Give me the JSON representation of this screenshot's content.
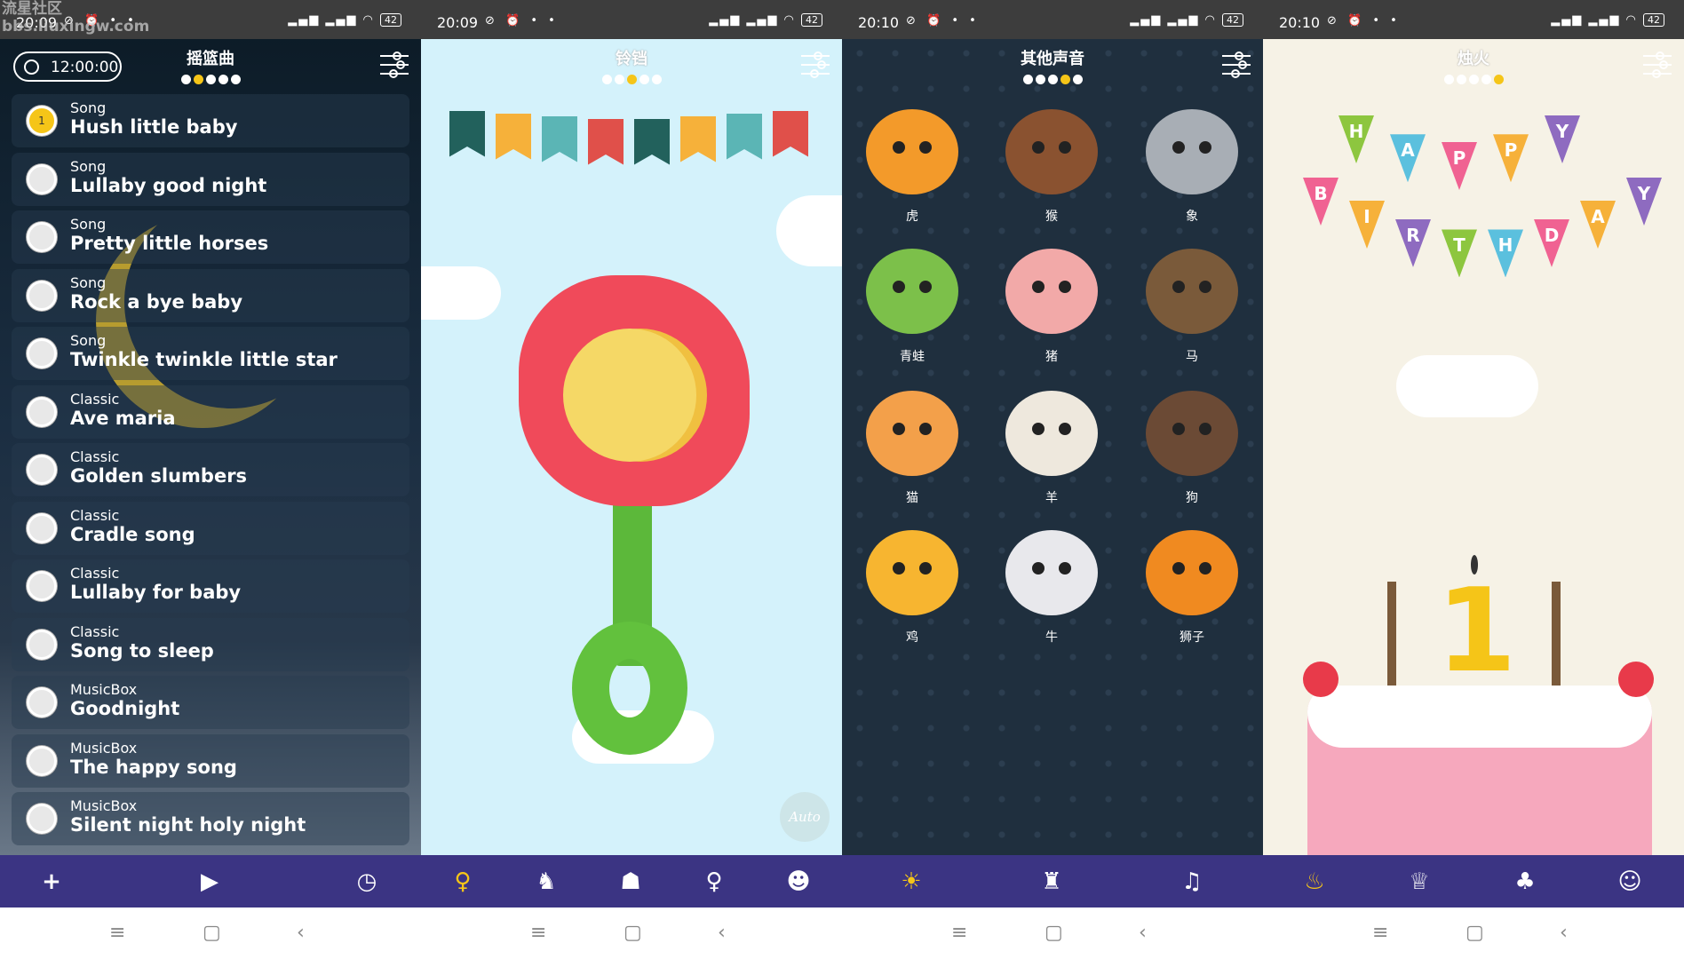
{
  "watermark": [
    "流星社区",
    "bbs.liuxingw.com"
  ],
  "status": [
    {
      "time": "20:09",
      "battery": "42"
    },
    {
      "time": "20:09",
      "battery": "42"
    },
    {
      "time": "20:10",
      "battery": "42"
    },
    {
      "time": "20:10",
      "battery": "42"
    }
  ],
  "lullaby": {
    "title": "摇篮曲",
    "timer": "12:00:00",
    "active_dot": 1,
    "items": [
      {
        "cat": "Song",
        "name": "Hush little baby",
        "selected": "1"
      },
      {
        "cat": "Song",
        "name": "Lullaby good night"
      },
      {
        "cat": "Song",
        "name": "Pretty little horses"
      },
      {
        "cat": "Song",
        "name": "Rock a bye baby"
      },
      {
        "cat": "Song",
        "name": "Twinkle twinkle little star"
      },
      {
        "cat": "Classic",
        "name": "Ave maria"
      },
      {
        "cat": "Classic",
        "name": "Golden slumbers"
      },
      {
        "cat": "Classic",
        "name": "Cradle song"
      },
      {
        "cat": "Classic",
        "name": "Lullaby for baby"
      },
      {
        "cat": "Classic",
        "name": "Song to sleep"
      },
      {
        "cat": "MusicBox",
        "name": "Goodnight"
      },
      {
        "cat": "MusicBox",
        "name": "The happy song"
      },
      {
        "cat": "MusicBox",
        "name": "Silent night holy night"
      }
    ]
  },
  "rattle": {
    "title": "铃铛",
    "active_dot": 2,
    "auto_label": "Auto",
    "flag_colors": [
      "#22615c",
      "#f6b13a",
      "#5bb5b5",
      "#e0504a",
      "#22615c",
      "#f6b13a",
      "#5bb5b5",
      "#e0504a"
    ]
  },
  "sounds": {
    "title": "其他声音",
    "active_dot": 3,
    "animals": [
      {
        "label": "虎",
        "color": "#f39a2a"
      },
      {
        "label": "猴",
        "color": "#8a5230"
      },
      {
        "label": "象",
        "color": "#a8aeb5"
      },
      {
        "label": "青蛙",
        "color": "#7cc04a"
      },
      {
        "label": "猪",
        "color": "#f2a9a8"
      },
      {
        "label": "马",
        "color": "#7a5a3a"
      },
      {
        "label": "猫",
        "color": "#f3a04a"
      },
      {
        "label": "羊",
        "color": "#eee8dd"
      },
      {
        "label": "狗",
        "color": "#6b4a35"
      },
      {
        "label": "鸡",
        "color": "#f7b530"
      },
      {
        "label": "牛",
        "color": "#e8e8ec"
      },
      {
        "label": "狮子",
        "color": "#f08a20"
      }
    ]
  },
  "candle": {
    "title": "烛火",
    "active_dot": 4,
    "banner_top": [
      "H",
      "A",
      "P",
      "P",
      "Y"
    ],
    "banner_bottom": [
      "B",
      "I",
      "R",
      "T",
      "H",
      "D",
      "A",
      "Y"
    ],
    "cake_number": "1"
  },
  "bottom_nav": [
    {
      "icon": "plus-icon",
      "glyph": "+"
    },
    {
      "icon": "play-icon",
      "glyph": "▶"
    },
    {
      "icon": "clock-icon",
      "glyph": "◷"
    },
    {
      "icon": "rattle-icon",
      "glyph": "♀",
      "active": true
    },
    {
      "icon": "duck-icon",
      "glyph": "♞"
    },
    {
      "icon": "bear-icon",
      "glyph": "☗"
    },
    {
      "icon": "pacifier-icon",
      "glyph": "♀"
    },
    {
      "icon": "bunny-icon",
      "glyph": "☻"
    },
    {
      "icon": "lion-icon",
      "glyph": "☀",
      "active": true
    },
    {
      "icon": "car-icon",
      "glyph": "♜"
    },
    {
      "icon": "xylophone-icon",
      "glyph": "♫"
    },
    {
      "icon": "cake-icon",
      "glyph": "♨",
      "active": true
    },
    {
      "icon": "cupcake-icon",
      "glyph": "♕"
    },
    {
      "icon": "tree-icon",
      "glyph": "♣"
    },
    {
      "icon": "pumpkin-icon",
      "glyph": "☺"
    }
  ],
  "colors": {
    "nav_bg": "#3b3483",
    "accent": "#f5c518"
  }
}
